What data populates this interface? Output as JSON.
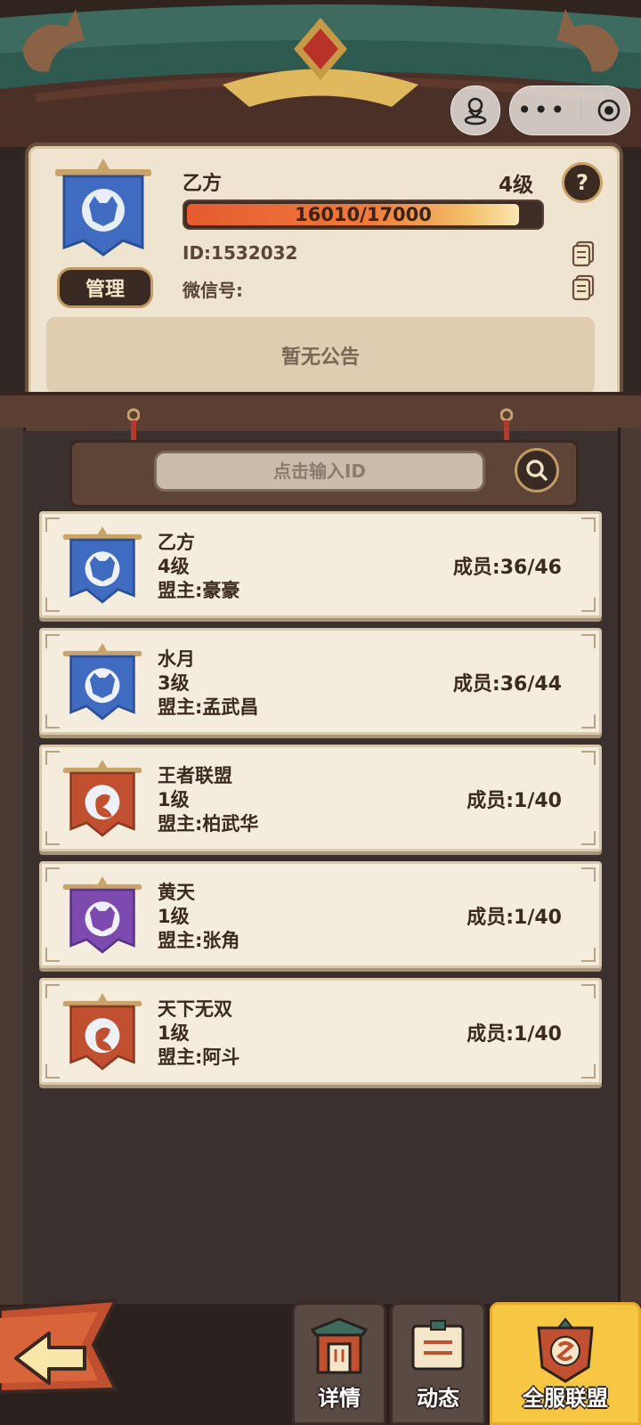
{
  "alliance": {
    "name": "乙方",
    "level": "4级",
    "progress_text": "16010/17000",
    "progress_fraction": 0.9418,
    "id_text": "ID:1532032",
    "wechat_label": "微信号:",
    "notice": "暂无公告",
    "manage_label": "管理",
    "help_glyph": "?"
  },
  "search": {
    "placeholder": "点击输入ID"
  },
  "list": [
    {
      "name": "乙方",
      "level": "4级",
      "leader": "盟主:豪豪",
      "members": "成员:36/46",
      "flag_color": "#3f6bc0",
      "flag_dark": "#2b4f94",
      "emblem": "tiger"
    },
    {
      "name": "水月",
      "level": "3级",
      "leader": "盟主:孟武昌",
      "members": "成员:36/44",
      "flag_color": "#3f6bc0",
      "flag_dark": "#2b4f94",
      "emblem": "tiger"
    },
    {
      "name": "王者联盟",
      "level": "1级",
      "leader": "盟主:柏武华",
      "members": "成员:1/40",
      "flag_color": "#c0502f",
      "flag_dark": "#8f3820",
      "emblem": "dragon"
    },
    {
      "name": "黄天",
      "level": "1级",
      "leader": "盟主:张角",
      "members": "成员:1/40",
      "flag_color": "#7d4bb0",
      "flag_dark": "#5a3384",
      "emblem": "tiger"
    },
    {
      "name": "天下无双",
      "level": "1级",
      "leader": "盟主:阿斗",
      "members": "成员:1/40",
      "flag_color": "#c0502f",
      "flag_dark": "#8f3820",
      "emblem": "dragon"
    }
  ],
  "tabs": [
    {
      "label": "详情",
      "icon": "gate-icon",
      "active": false
    },
    {
      "label": "动态",
      "icon": "notice-board-icon",
      "active": false
    },
    {
      "label": "全服联盟",
      "icon": "alliance-shield-icon",
      "active": true
    }
  ],
  "colors": {
    "accent_yellow": "#f7c642",
    "progress_orange": "#e55b2f",
    "panel_bg": "#efe4cf",
    "row_bg": "#f4ecdc"
  }
}
